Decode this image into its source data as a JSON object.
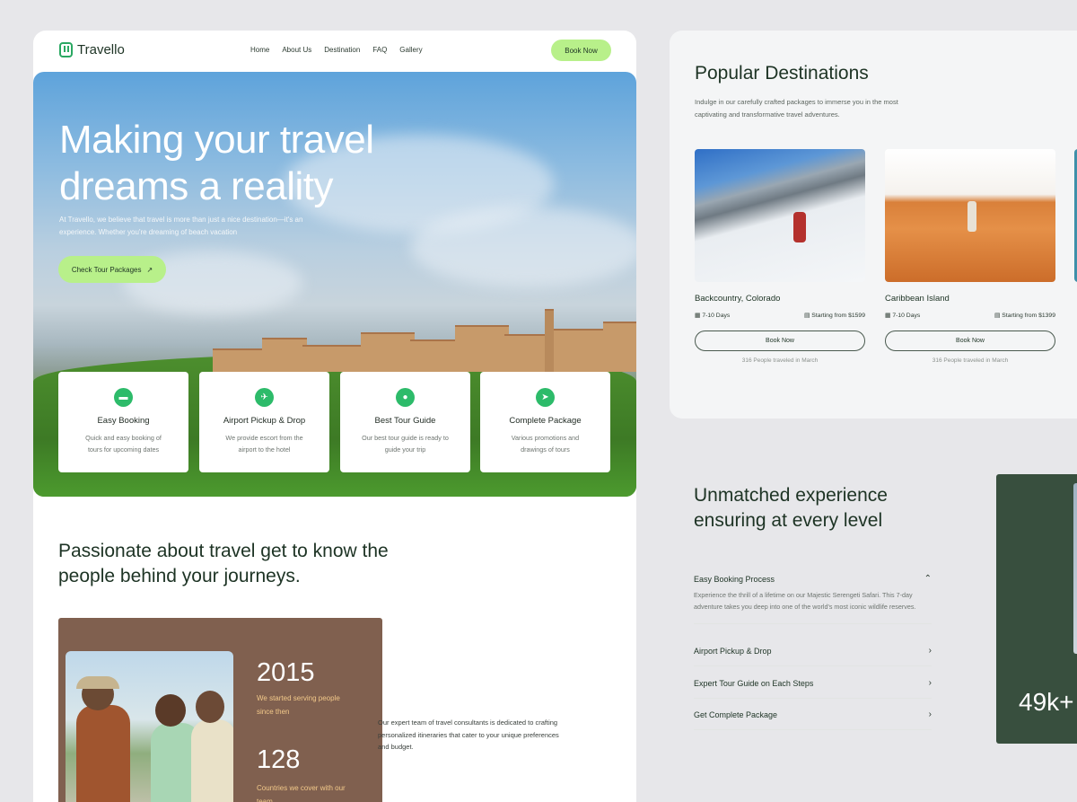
{
  "nav": {
    "brand": "Travello",
    "links": [
      "Home",
      "About Us",
      "Destination",
      "FAQ",
      "Gallery"
    ],
    "book_now": "Book Now"
  },
  "hero": {
    "title": "Making your travel dreams a reality",
    "subtitle": "At Travello, we believe that travel is more than just a nice destination—it's an experience. Whether you're dreaming of beach vacation",
    "cta": "Check Tour Packages"
  },
  "features": [
    {
      "title": "Easy Booking",
      "desc": "Quick and easy booking of tours for upcoming dates",
      "icon": "ticket-icon"
    },
    {
      "title": "Airport Pickup & Drop",
      "desc": "We provide escort from the airport to the hotel",
      "icon": "plane-icon"
    },
    {
      "title": "Best Tour Guide",
      "desc": "Our best tour guide is ready to guide your trip",
      "icon": "people-icon"
    },
    {
      "title": "Complete Package",
      "desc": "Various promotions and drawings of tours",
      "icon": "send-icon"
    }
  ],
  "about": {
    "title": "Passionate about travel get to know the people behind your journeys.",
    "stat1_num": "2015",
    "stat1_label": "We started serving people since then",
    "stat2_num": "128",
    "stat2_label": "Countries we cover with our team",
    "team_text": "Our expert team of travel consultants is dedicated to crafting personalized itineraries that cater to your unique preferences and budget."
  },
  "popular": {
    "title": "Popular Destinations",
    "subtitle": "Indulge in our carefully crafted packages to immerse you in the most captivating and transformative travel adventures.",
    "destinations": [
      {
        "name": "Backcountry, Colorado",
        "days": "7-10 Days",
        "price": "Starting from $1599",
        "button": "Book Now",
        "note": "316 People traveled in March"
      },
      {
        "name": "Caribbean Island",
        "days": "7-10 Days",
        "price": "Starting from $1399",
        "button": "Book Now",
        "note": "316 People traveled in March"
      }
    ]
  },
  "experience": {
    "title": "Unmatched experience ensuring at every level",
    "items": [
      {
        "label": "Easy Booking Process",
        "body": "Experience the thrill of a lifetime on our Majestic Serengeti Safari. This 7-day adventure takes you deep into one of the world's most iconic wildlife reserves."
      },
      {
        "label": "Airport Pickup & Drop"
      },
      {
        "label": "Expert Tour Guide on Each Steps"
      },
      {
        "label": "Get Complete Package"
      }
    ],
    "stat": "49k+"
  },
  "colors": {
    "accent": "#b8f08a",
    "brand_green": "#2dbb6a",
    "brown": "#80604f",
    "dark_green": "#384f3e"
  }
}
